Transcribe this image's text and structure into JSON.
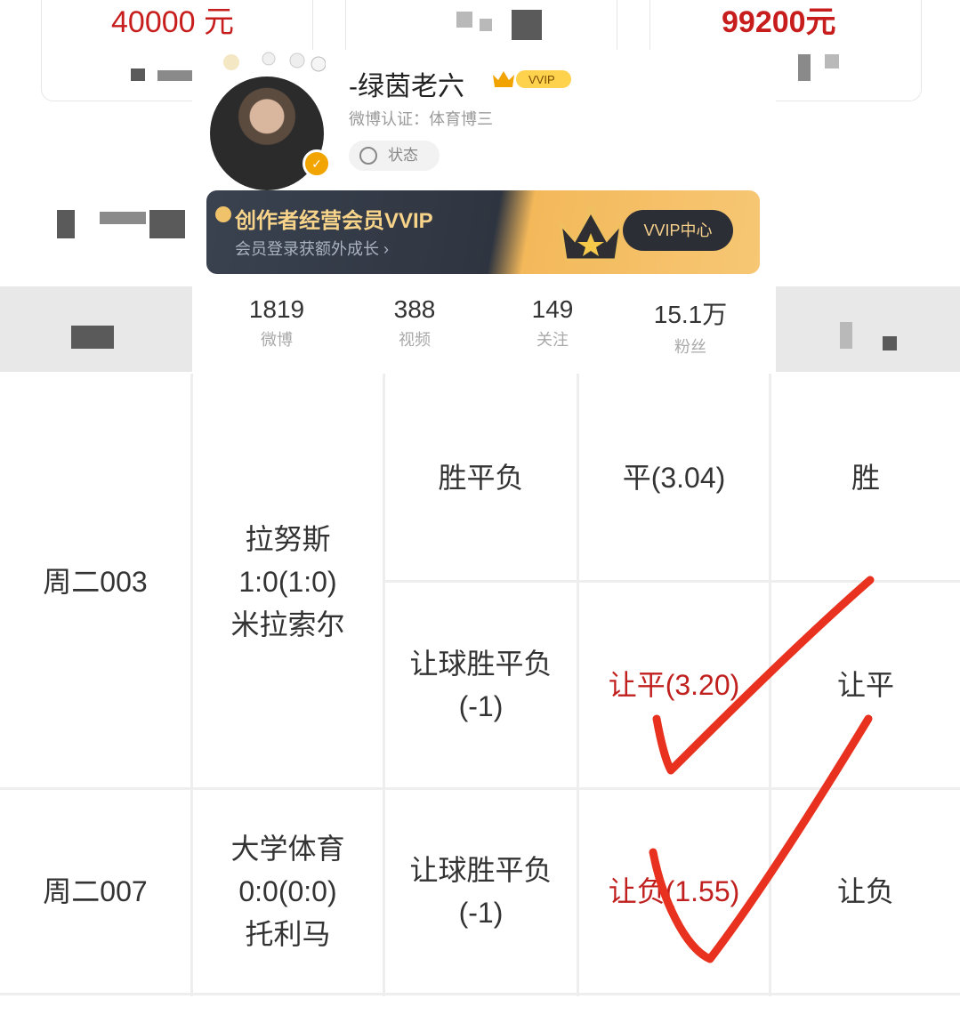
{
  "top_cards": {
    "left_amount": "40000 元",
    "right_amount": "99200元"
  },
  "profile": {
    "nickname": "-绿茵老六",
    "vip_badge": "VVIP",
    "certification": "微博认证：体育博三",
    "status_label": "状态",
    "banner": {
      "title": "创作者经营会员VVIP",
      "subtitle": "会员登录获额外成长 ›",
      "button": "VVIP中心"
    },
    "stats": [
      {
        "value": "1819",
        "label": "微博"
      },
      {
        "value": "388",
        "label": "视频"
      },
      {
        "value": "149",
        "label": "关注"
      },
      {
        "value": "15.1万",
        "label": "粉丝"
      }
    ]
  },
  "table": {
    "rows": [
      {
        "match_id": "周二003",
        "match": "拉努斯\n1:0(1:0)\n米拉索尔",
        "bets": [
          {
            "type": "胜平负",
            "pick": "平(3.04)",
            "result": "胜",
            "pick_color": "normal"
          },
          {
            "type": "让球胜平负\n(-1)",
            "pick": "让平(3.20)",
            "result": "让平",
            "pick_color": "red"
          }
        ]
      },
      {
        "match_id": "周二007",
        "match": "大学体育\n0:0(0:0)\n托利马",
        "bets": [
          {
            "type": "让球胜平负\n(-1)",
            "pick": "让负(1.55)",
            "result": "让负",
            "pick_color": "red"
          }
        ]
      }
    ]
  },
  "colors": {
    "accent_red": "#c0201e",
    "checkmark_red": "#e8321f",
    "banner_gold": "#f7c774"
  }
}
